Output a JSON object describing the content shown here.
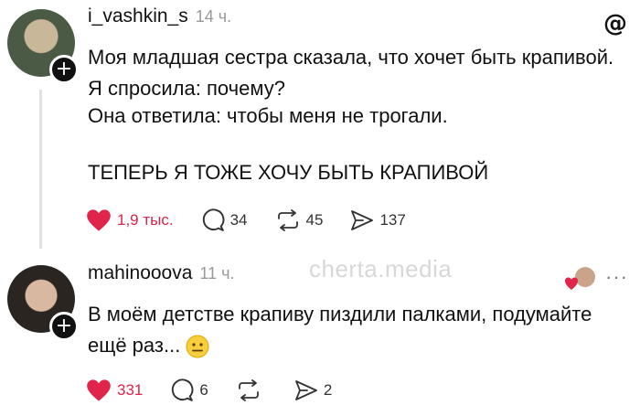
{
  "post": {
    "username": "i_vashkin_s",
    "time": "14 ч.",
    "line1": "Моя младшая сестра сказала, что хочет быть крапивой. Я спросила: почему?",
    "line2": "Она ответила: чтобы меня не трогали.",
    "line3": "ТЕПЕРЬ Я ТОЖЕ ХОЧУ БЫТЬ КРАПИВОЙ",
    "likes": "1,9 тыс.",
    "comments": "34",
    "reposts": "45",
    "shares": "137"
  },
  "reply": {
    "username": "mahinooova",
    "time": "11 ч.",
    "text": "В моём детстве крапиву пиздили палками, подумайте ещё раз...",
    "likes": "331",
    "comments": "6",
    "reposts": "",
    "shares": "2"
  },
  "watermark": "cherta.media",
  "colors": {
    "heart": "#e0244a",
    "secondary": "#999999",
    "text": "#111111"
  },
  "icons": [
    "heart-icon",
    "comment-icon",
    "repost-icon",
    "share-icon",
    "threads-logo-icon",
    "more-icon",
    "plus-icon",
    "neutral-face-emoji"
  ]
}
